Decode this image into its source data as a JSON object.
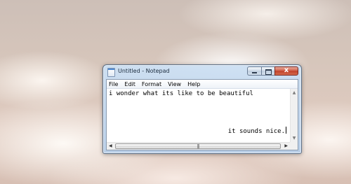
{
  "window": {
    "title": "Untitled - Notepad"
  },
  "menu": {
    "file": "File",
    "edit": "Edit",
    "format": "Format",
    "view": "View",
    "help": "Help"
  },
  "editor": {
    "line1": "i wonder what its like to be beautiful",
    "line2": "it sounds nice."
  },
  "caption": {
    "close_glyph": "x"
  },
  "scrollbar": {
    "up_glyph": "▲",
    "down_glyph": "▼",
    "left_glyph": "◀",
    "right_glyph": "▶",
    "grip_glyph": "|||"
  },
  "icons": {
    "app": "notepad-icon",
    "minimize": "minimize-icon",
    "maximize": "maximize-icon",
    "close": "close-icon"
  },
  "colors": {
    "titlebar": "#c3d6ec",
    "close_button": "#c7462d",
    "editor_background": "#ffffff"
  }
}
